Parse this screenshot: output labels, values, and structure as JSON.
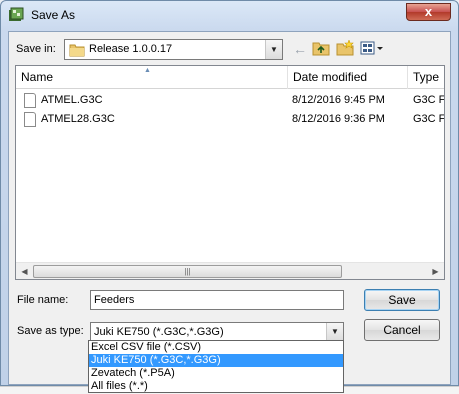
{
  "window": {
    "title": "Save As",
    "close_glyph": "x"
  },
  "toolbar": {
    "save_in_label": "Save in:",
    "save_in_value": "Release 1.0.0.17",
    "back_icon": "back-arrow-icon",
    "up_icon": "up-folder-icon",
    "new_folder_icon": "new-folder-icon",
    "views_icon": "views-menu-icon"
  },
  "filelist": {
    "columns": [
      {
        "label": "Name"
      },
      {
        "label": "Date modified"
      },
      {
        "label": "Type"
      }
    ],
    "rows": [
      {
        "name": "ATMEL.G3C",
        "date": "8/12/2016 9:45 PM",
        "type": "G3C F"
      },
      {
        "name": "ATMEL28.G3C",
        "date": "8/12/2016 9:36 PM",
        "type": "G3C F"
      }
    ]
  },
  "form": {
    "file_name_label": "File name:",
    "file_name_value": "Feeders",
    "save_as_type_label": "Save as type:",
    "save_as_type_value": "Juki KE750 (*.G3C,*.G3G)",
    "save_label": "Save",
    "cancel_label": "Cancel"
  },
  "type_options": [
    {
      "label": "Excel CSV file (*.CSV)",
      "selected": false
    },
    {
      "label": "Juki KE750 (*.G3C,*.G3G)",
      "selected": true
    },
    {
      "label": "Zevatech (*.P5A)",
      "selected": false
    },
    {
      "label": "All files (*.*)",
      "selected": false
    }
  ],
  "colors": {
    "selection": "#3399ff",
    "close_button": "#c75050",
    "window_frame": "#cad9ee"
  }
}
